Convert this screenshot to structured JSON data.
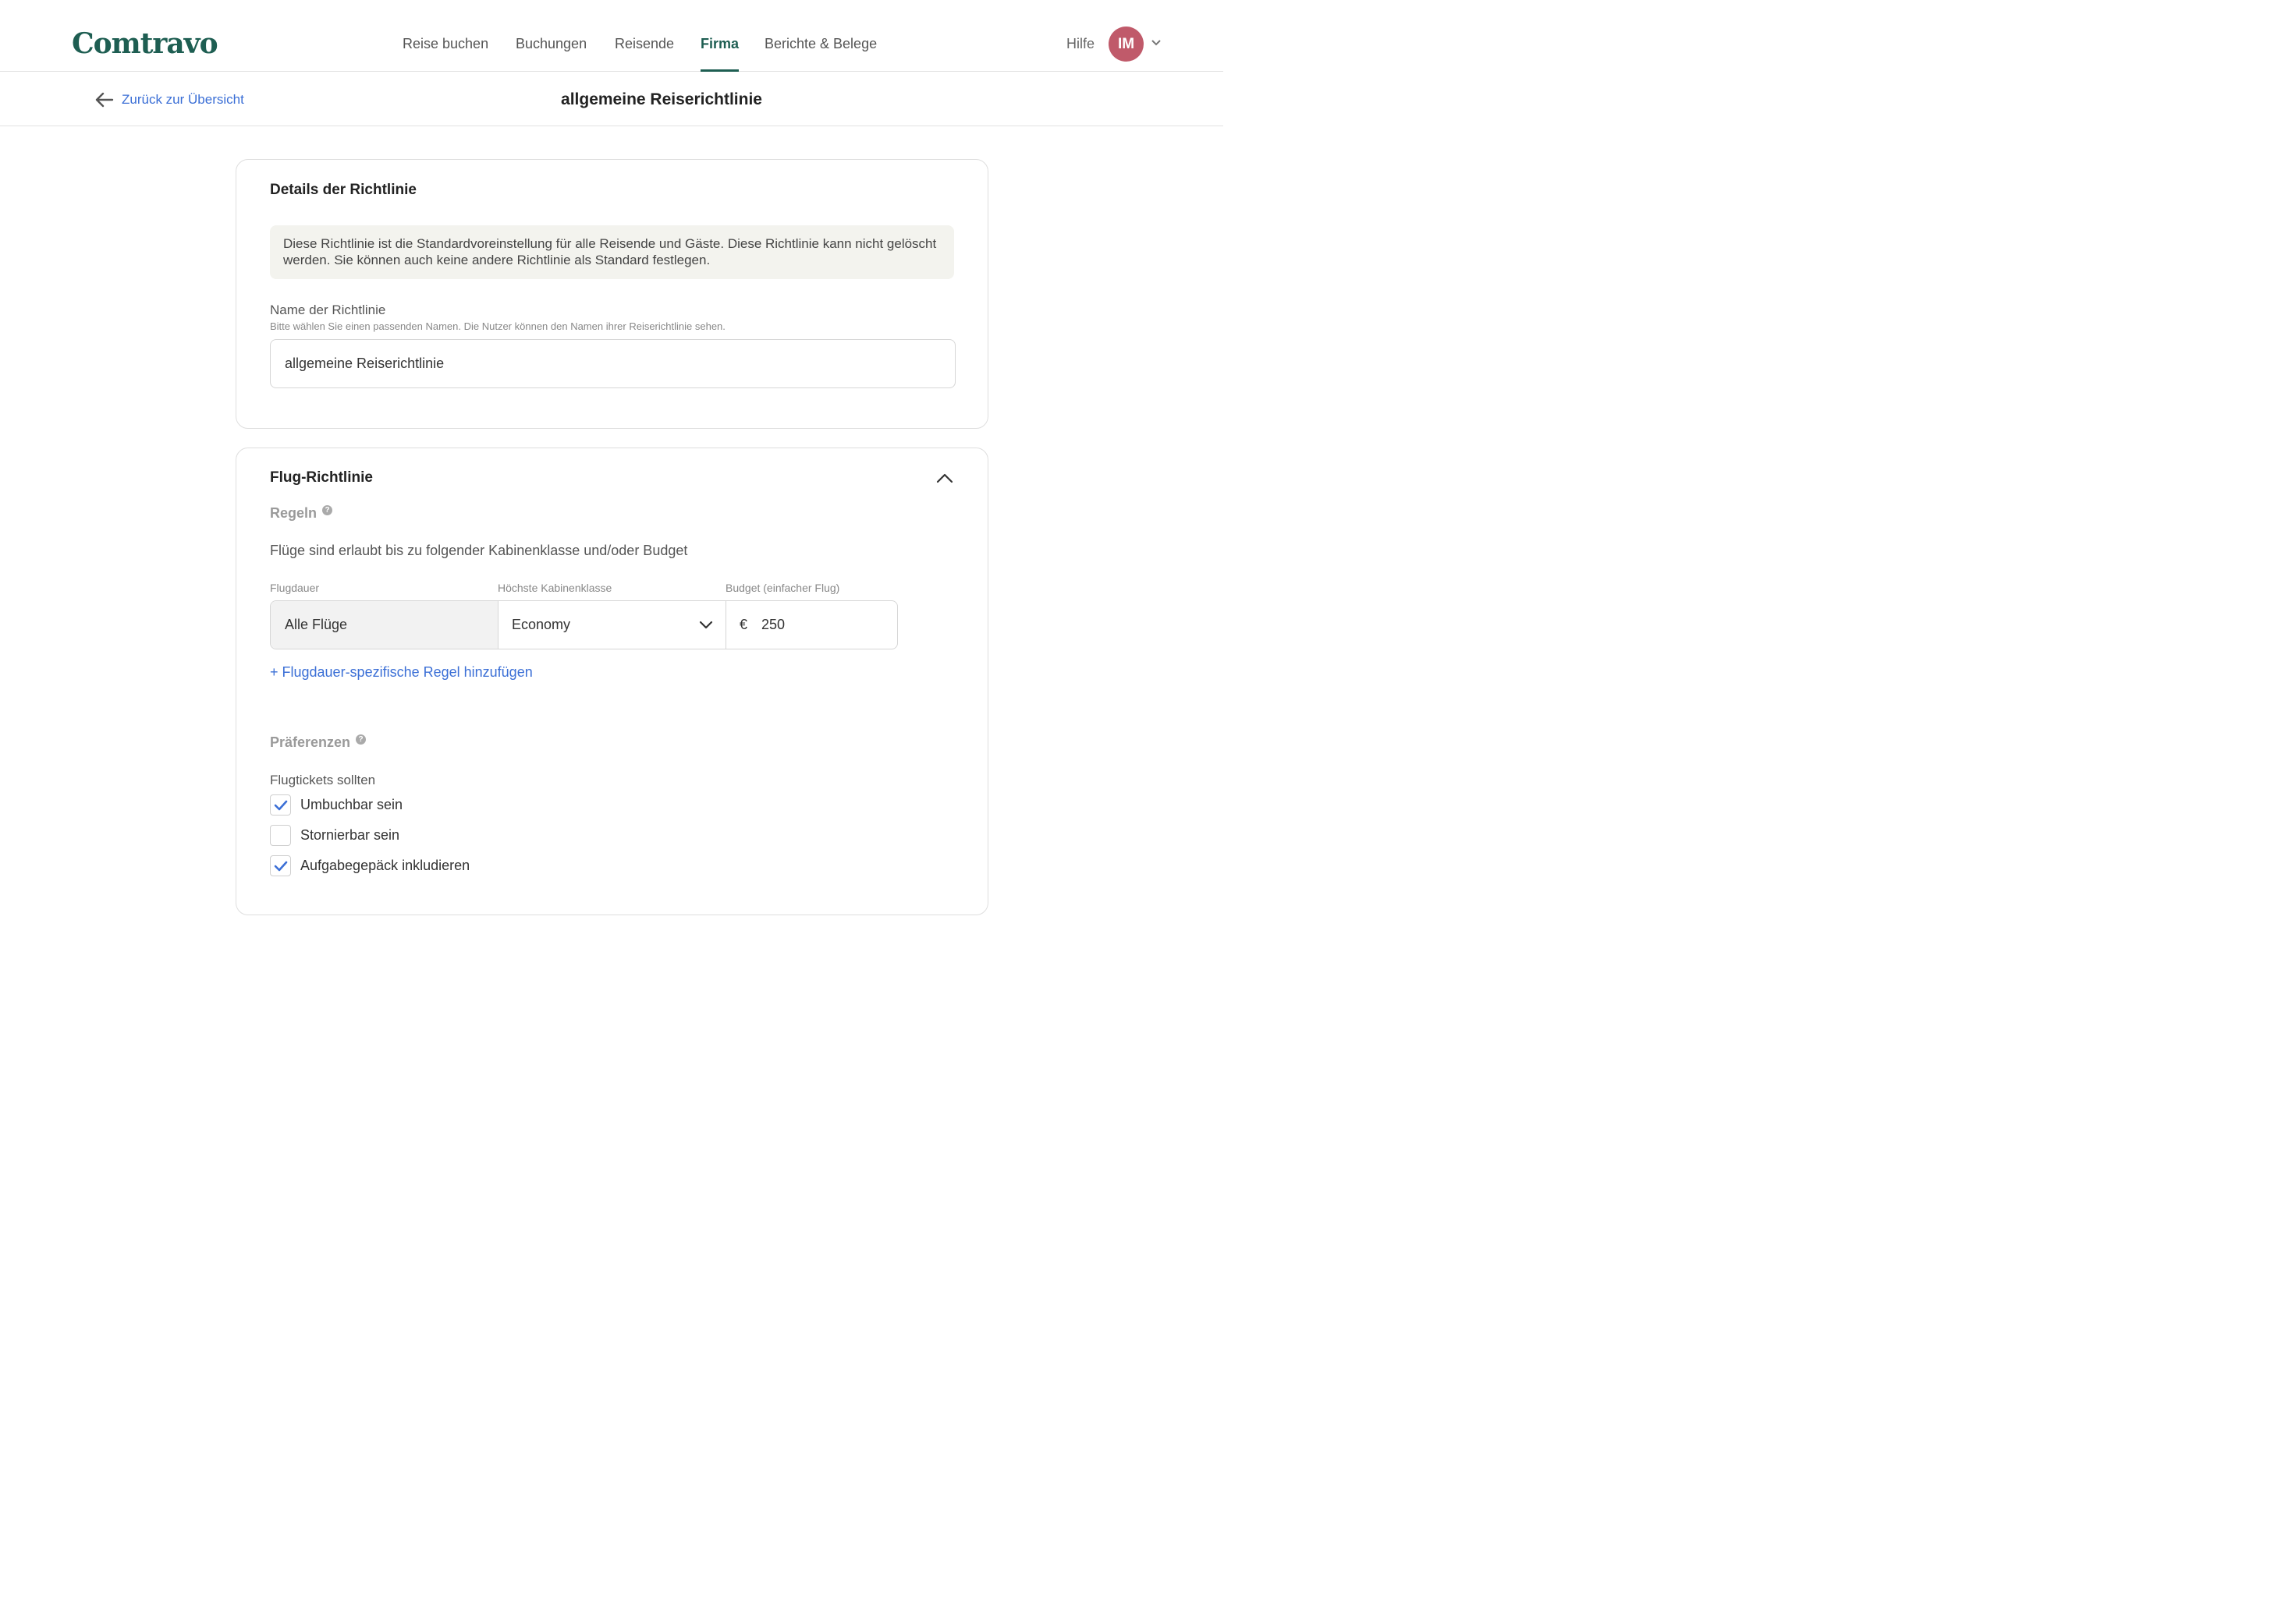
{
  "brand": {
    "logo": "Comtravo",
    "color": "#1e5e52"
  },
  "nav": {
    "items": [
      {
        "label": "Reise buchen"
      },
      {
        "label": "Buchungen"
      },
      {
        "label": "Reisende"
      },
      {
        "label": "Firma",
        "active": true
      },
      {
        "label": "Berichte & Belege"
      }
    ],
    "help": "Hilfe",
    "avatar_initials": "IM",
    "avatar_color": "#c05a6a"
  },
  "subheader": {
    "back_label": "Zurück zur Übersicht",
    "title": "allgemeine Reiserichtlinie"
  },
  "details": {
    "title": "Details der Richtlinie",
    "notice": "Diese Richtlinie ist die Standardvoreinstellung für alle Reisende und Gäste. Diese Richtlinie kann nicht gelöscht werden. Sie können auch keine andere Richtlinie als Standard festlegen.",
    "name_label": "Name der Richtlinie",
    "name_hint": "Bitte wählen Sie einen passenden Namen. Die Nutzer können den Namen ihrer Reiserichtlinie sehen.",
    "name_value": "allgemeine Reiserichtlinie"
  },
  "flight": {
    "title": "Flug-Richtlinie",
    "rules_label": "Regeln",
    "rules_text": "Flüge sind erlaubt bis zu folgender Kabinenklasse und/oder Budget",
    "col_duration": "Flugdauer",
    "col_class": "Höchste Kabinenklasse",
    "col_budget": "Budget (einfacher Flug)",
    "duration_value": "Alle Flüge",
    "class_value": "Economy",
    "currency": "€",
    "budget_value": "250",
    "add_rule": "+ Flugdauer-spezifische Regel hinzufügen",
    "prefs_label": "Präferenzen",
    "tickets_label": "Flugtickets sollten",
    "options": [
      {
        "label": "Umbuchbar sein",
        "checked": true
      },
      {
        "label": "Stornierbar sein",
        "checked": false
      },
      {
        "label": "Aufgabegepäck inkludieren",
        "checked": true
      }
    ],
    "accent": "#3b6fd6"
  }
}
